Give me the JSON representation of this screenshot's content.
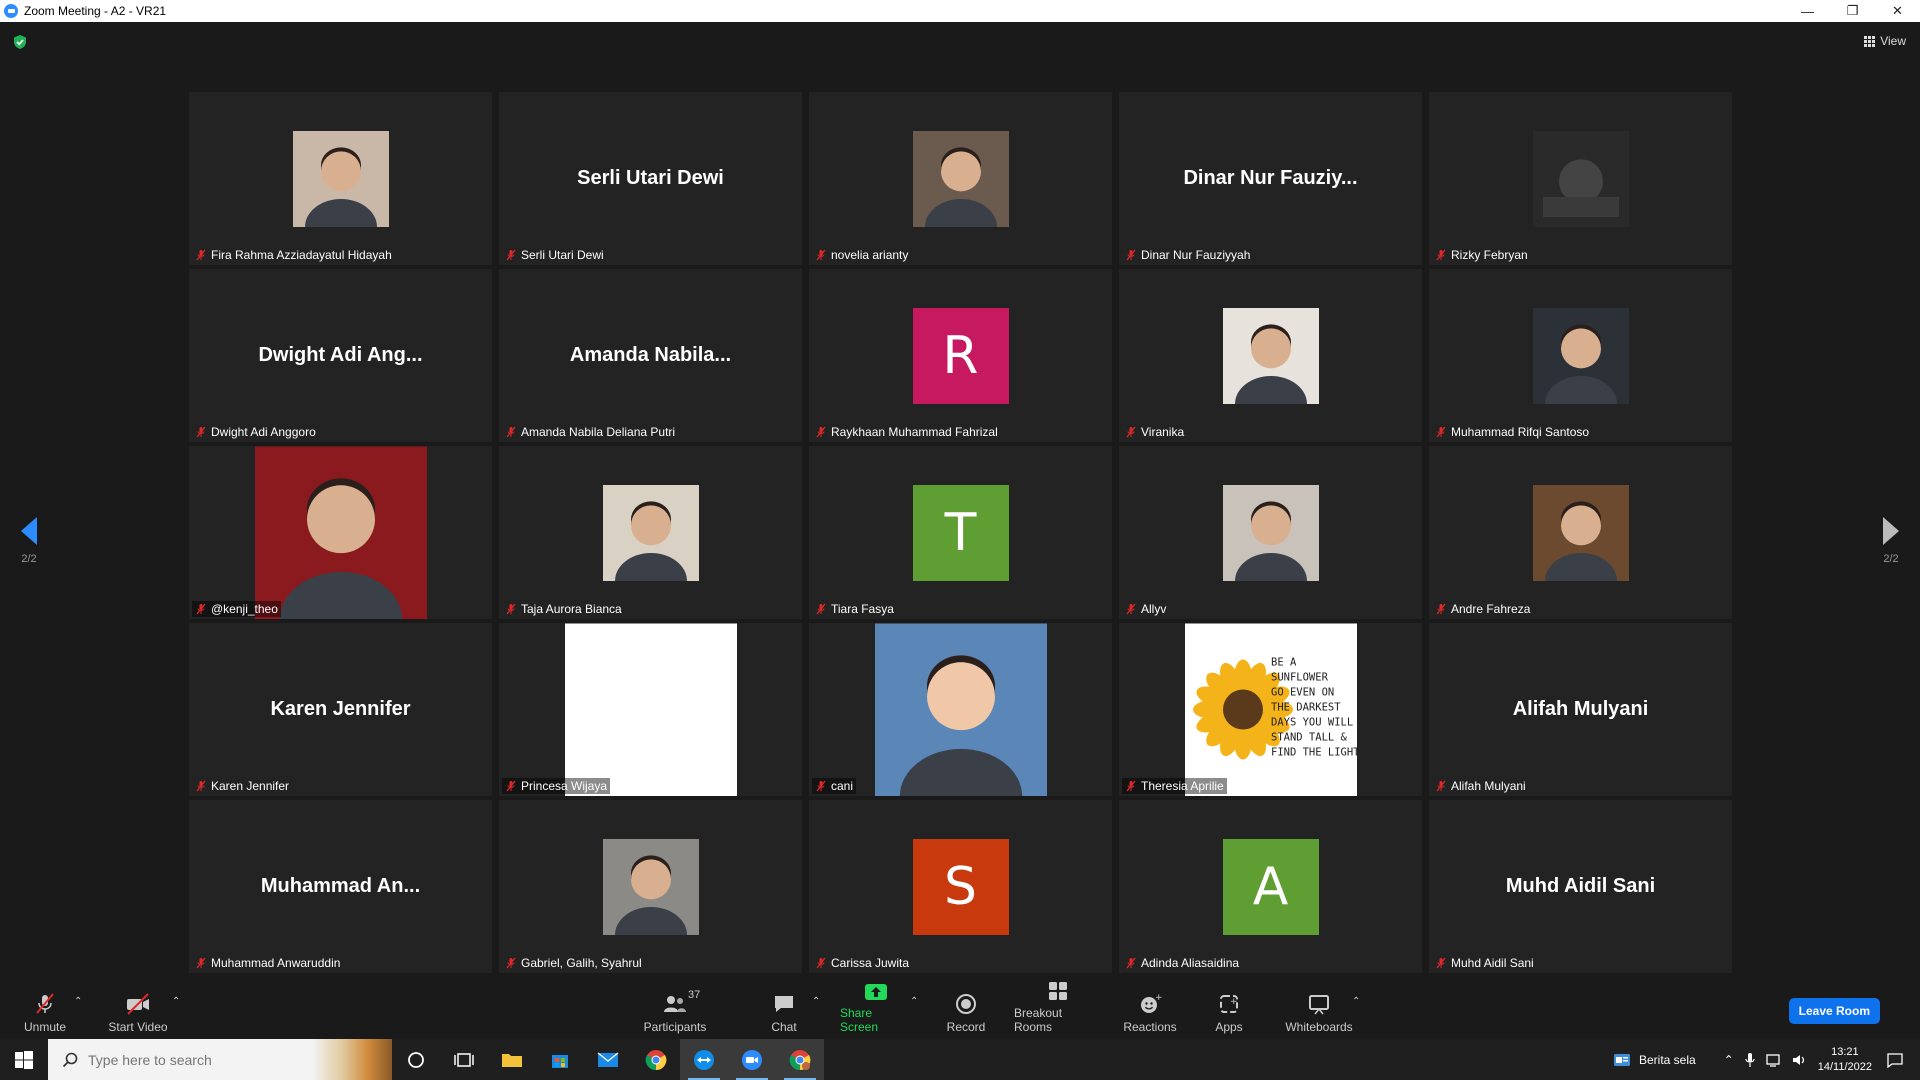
{
  "window": {
    "title": "Zoom Meeting - A2 - VR21"
  },
  "header": {
    "view_label": "View"
  },
  "pager": {
    "left": "2/2",
    "right": "2/2"
  },
  "participants": [
    {
      "name": "Fira Rahma Azziadayatul Hidayah",
      "display": "",
      "type": "photo",
      "color": "#c9b8a8",
      "icon": "person-photo"
    },
    {
      "name": "Serli Utari Dewi",
      "display": "Serli Utari Dewi",
      "type": "name"
    },
    {
      "name": "novelia arianty",
      "display": "",
      "type": "photo",
      "color": "#6b5a4e",
      "icon": "person-photo"
    },
    {
      "name": "Dinar Nur Fauziyyah",
      "display": "Dinar Nur Fauziy...",
      "type": "name"
    },
    {
      "name": "Rizky Febryan",
      "display": "",
      "type": "photo",
      "color": "#3a3a3a",
      "icon": "dark-photo"
    },
    {
      "name": "Dwight Adi Anggoro",
      "display": "Dwight Adi Ang...",
      "type": "name"
    },
    {
      "name": "Amanda Nabila Deliana Putri",
      "display": "Amanda Nabila...",
      "type": "name"
    },
    {
      "name": "Raykhaan Muhammad Fahrizal",
      "display": "",
      "type": "avatar",
      "letter": "R",
      "color": "#c7195f"
    },
    {
      "name": "Viranika",
      "display": "",
      "type": "photo",
      "color": "#e8e2dc",
      "icon": "person-photo"
    },
    {
      "name": "Muhammad Rifqi Santoso",
      "display": "",
      "type": "photo",
      "color": "#2c3138",
      "icon": "person-photo"
    },
    {
      "name": "@kenji_theo",
      "display": "",
      "type": "photo-wide",
      "color": "#8a1a1e",
      "icon": "person-photo"
    },
    {
      "name": "Taja Aurora Bianca",
      "display": "",
      "type": "photo",
      "color": "#d9d2c4",
      "icon": "person-photo"
    },
    {
      "name": "Tiara Fasya",
      "display": "",
      "type": "avatar",
      "letter": "T",
      "color": "#5f9e33"
    },
    {
      "name": "Allyv",
      "display": "",
      "type": "photo",
      "color": "#c8c2bb",
      "icon": "person-photo"
    },
    {
      "name": "Andre Fahreza",
      "display": "",
      "type": "photo",
      "color": "#6b4a30",
      "icon": "person-photo"
    },
    {
      "name": "Karen Jennifer",
      "display": "Karen Jennifer",
      "type": "name"
    },
    {
      "name": "Princesa Wijaya",
      "display": "",
      "type": "photo-wide",
      "color": "#ffffff",
      "icon": "blank-image"
    },
    {
      "name": "cani",
      "display": "",
      "type": "photo-wide",
      "color": "#5a86b8",
      "icon": "child-photo"
    },
    {
      "name": "Theresia Aprilie",
      "display": "",
      "type": "photo-wide",
      "color": "#ffffff",
      "icon": "sunflower-quote",
      "quote": "BE A SUNFLOWER GO EVEN ON THE DARKEST DAYS YOU WILL STAND TALL & FIND THE LIGHT"
    },
    {
      "name": "Alifah Mulyani",
      "display": "Alifah Mulyani",
      "type": "name"
    },
    {
      "name": "Muhammad Anwaruddin",
      "display": "Muhammad An...",
      "type": "name"
    },
    {
      "name": "Gabriel, Galih, Syahrul",
      "display": "",
      "type": "photo",
      "color": "#8c8a86",
      "icon": "person-photo"
    },
    {
      "name": "Carissa Juwita",
      "display": "",
      "type": "avatar",
      "letter": "S",
      "color": "#c8390d"
    },
    {
      "name": "Adinda Aliasaidina",
      "display": "",
      "type": "avatar",
      "letter": "A",
      "color": "#5f9e33"
    },
    {
      "name": "Muhd Aidil Sani",
      "display": "Muhd Aidil Sani",
      "type": "name"
    }
  ],
  "toolbar": {
    "unmute": "Unmute",
    "start_video": "Start Video",
    "participants": "Participants",
    "participants_count": "37",
    "chat": "Chat",
    "share_screen": "Share Screen",
    "record": "Record",
    "breakout_rooms": "Breakout Rooms",
    "reactions": "Reactions",
    "apps": "Apps",
    "whiteboards": "Whiteboards",
    "leave": "Leave Room"
  },
  "taskbar": {
    "search_placeholder": "Type here to search",
    "news": "Berita sela",
    "time": "13:21",
    "date": "14/11/2022"
  }
}
